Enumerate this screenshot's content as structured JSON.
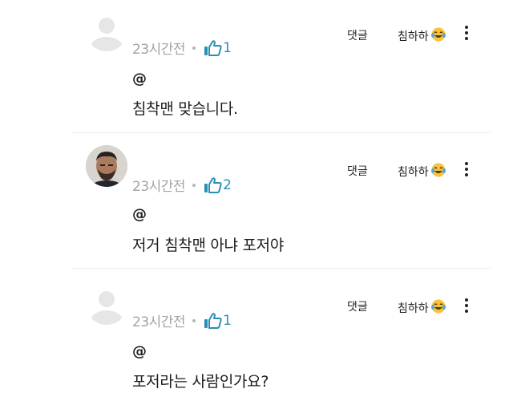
{
  "comments": [
    {
      "time": "23시간전",
      "likes": "1",
      "mention": "@",
      "text": "침착맨 맞습니다.",
      "reply_label": "댓글",
      "reaction_label": "침하하",
      "reaction_icon": "laughing-tears-emoji",
      "avatar": "default-avatar"
    },
    {
      "time": "23시간전",
      "likes": "2",
      "mention": "@",
      "text": "저거 침착맨 아냐 포저야",
      "reply_label": "댓글",
      "reaction_label": "침하하",
      "reaction_icon": "laughing-tears-emoji",
      "avatar": "user-photo"
    },
    {
      "time": "23시간전",
      "likes": "1",
      "mention": "@",
      "text": "포저라는 사람인가요?",
      "reply_label": "댓글",
      "reaction_label": "침하하",
      "reaction_icon": "laughing-tears-emoji",
      "avatar": "default-avatar"
    }
  ],
  "colors": {
    "accent": "#2a8fb5",
    "meta": "#a3a3a3",
    "divider": "#ececec"
  }
}
